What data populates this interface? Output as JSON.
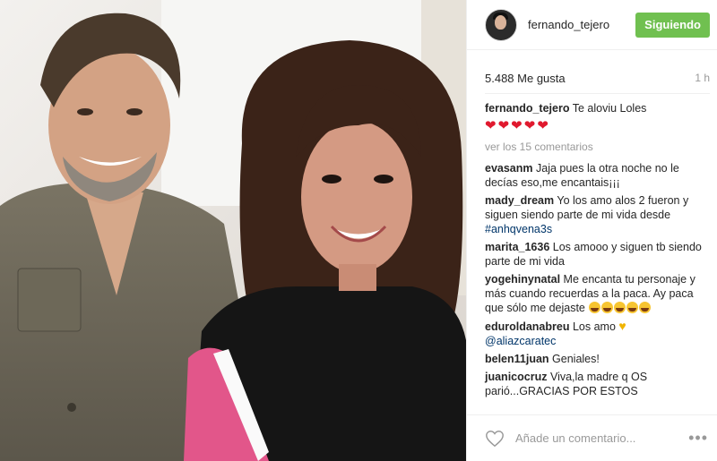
{
  "post": {
    "username": "fernando_tejero",
    "follow_label": "Siguiendo",
    "likes": "5.488 Me gusta",
    "time": "1 h",
    "caption_author": "fernando_tejero",
    "caption_text": "Te aloviu Loles",
    "caption_hearts": [
      "❤",
      "❤",
      "❤",
      "❤",
      "❤"
    ],
    "view_more": "ver los 15 comentarios"
  },
  "comments": [
    {
      "author": "evasanm",
      "text": "Jaja pues la otra noche no le decías eso,me encantais¡¡¡"
    },
    {
      "author": "mady_dream",
      "text": "Yo los amo alos 2 fueron y siguen siendo parte de mi vida desde ",
      "hashtag": "#anhqvena3s"
    },
    {
      "author": "marita_1636",
      "text": "Los amooo y siguen tb siendo parte de mi vida"
    },
    {
      "author": "yogehinynatal",
      "text": "Me encanta tu personaje y más cuando recuerdas a la paca. Ay paca que sólo me dejaste"
    },
    {
      "author": "eduroldanabreu",
      "text": "Los amo",
      "mention": "@aliazcaratec"
    },
    {
      "author": "belen11juan",
      "text": "Geniales!"
    },
    {
      "author": "juanicocruz",
      "text": "Viva,la madre q OS parió...GRACIAS POR ESTOS"
    }
  ],
  "footer": {
    "placeholder": "Añade un comentario...",
    "more": "•••"
  },
  "icons": {
    "avatar": "profile-avatar",
    "like": "heart-outline-icon",
    "more": "more-options-icon"
  },
  "colors": {
    "follow_button": "#70c050",
    "link": "#003569",
    "heart": "#e0192e"
  }
}
